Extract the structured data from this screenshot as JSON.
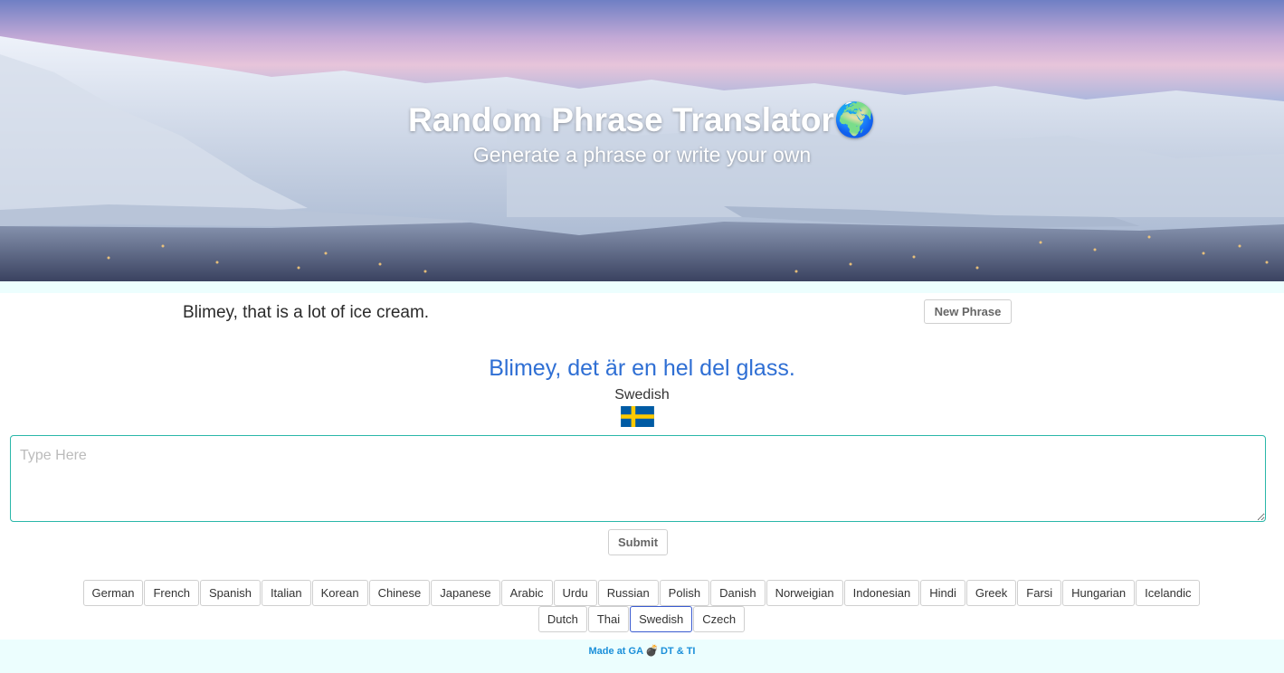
{
  "header": {
    "title": "Random Phrase Translator",
    "globe_icon": "🌍",
    "subtitle": "Generate a phrase or write your own"
  },
  "phrase": {
    "text": "Blimey, that is a lot of ice cream.",
    "new_phrase_label": "New Phrase"
  },
  "translation": {
    "text": "Blimey, det är en hel del glass.",
    "language": "Swedish",
    "flag_icon": "sweden-flag-icon",
    "flag_colors": {
      "blue": "#005ba4",
      "yellow": "#fcc900"
    }
  },
  "input": {
    "placeholder": "Type Here",
    "value": "",
    "submit_label": "Submit"
  },
  "languages": {
    "row1": [
      "German",
      "French",
      "Spanish",
      "Italian",
      "Korean",
      "Chinese",
      "Japanese",
      "Arabic",
      "Urdu",
      "Russian",
      "Polish",
      "Danish",
      "Norweigian",
      "Indonesian",
      "Hindi",
      "Greek",
      "Farsi",
      "Hungarian",
      "Icelandic"
    ],
    "row2": [
      "Dutch",
      "Thai",
      "Swedish",
      "Czech"
    ],
    "selected": "Swedish"
  },
  "footer": {
    "prefix": "Made at GA",
    "bomb_icon": "💣",
    "suffix": "DT & TI"
  },
  "colors": {
    "accent_blue": "#2f6fd4",
    "input_border": "#2ab7a9",
    "footer_bg": "#ecfefe",
    "footer_text": "#1a8fd9"
  }
}
